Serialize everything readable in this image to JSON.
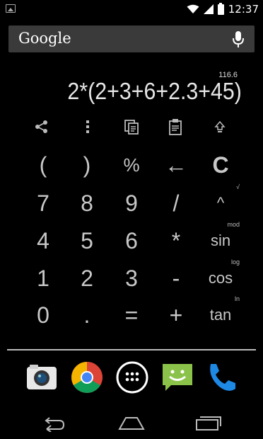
{
  "status_bar": {
    "time": "12:37"
  },
  "search_bar": {
    "logo_text": "Google"
  },
  "display": {
    "result_preview": "116.6",
    "expression": "2*(2+3+6+2.3+45)"
  },
  "toolbar": [
    "share-icon",
    "overflow-menu-icon",
    "copy-icon",
    "paste-icon",
    "expand-icon"
  ],
  "keypad": {
    "rows": [
      [
        "(",
        ")",
        "%",
        "←",
        "C"
      ],
      [
        "7",
        "8",
        "9",
        "/",
        "^"
      ],
      [
        "4",
        "5",
        "6",
        "*",
        "sin"
      ],
      [
        "1",
        "2",
        "3",
        "-",
        "cos"
      ],
      [
        "0",
        ".",
        "=",
        "+",
        "tan"
      ]
    ],
    "secondary": {
      "pow": "√",
      "sin": "mod",
      "cos": "log",
      "tan": "ln"
    }
  },
  "dock": [
    "camera-app-icon",
    "chrome-app-icon",
    "app-drawer-icon",
    "messaging-app-icon",
    "phone-app-icon"
  ],
  "navigation": [
    "back-icon",
    "home-icon",
    "recents-icon"
  ],
  "colors": {
    "background": "#000000",
    "search_bar": "#3a3a3a",
    "key_text": "#c8c8c8",
    "display_text": "#e6e6e6"
  }
}
